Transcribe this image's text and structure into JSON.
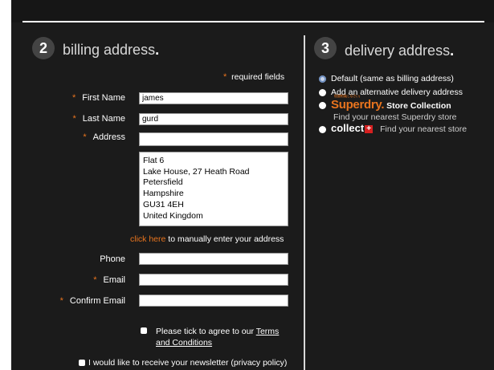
{
  "billing": {
    "step_number": "2",
    "title": "billing address",
    "required_note": "required fields",
    "first_name_label": "First Name",
    "first_name_value": "james",
    "last_name_label": "Last Name",
    "last_name_value": "gurd",
    "address_label": "Address",
    "address_value": "",
    "address_lines": [
      "Flat 6",
      "Lake House, 27 Heath Road",
      "Petersfield",
      "Hampshire",
      "GU31 4EH",
      "United Kingdom"
    ],
    "manual_link": "click here",
    "manual_text": " to manually enter your address",
    "phone_label": "Phone",
    "email_label": "Email",
    "confirm_email_label": "Confirm Email",
    "terms_prefix": "Please tick to agree to our ",
    "terms_link_1": "Terms",
    "terms_link_2": "and Conditions",
    "newsletter_text": "I would like to receive your newsletter (privacy policy)"
  },
  "delivery": {
    "step_number": "3",
    "title": "delivery address",
    "options": [
      {
        "label": "Default (same as billing address)"
      },
      {
        "label": "Add an alternative delivery address"
      }
    ],
    "superdry_logo": "Superdry.",
    "superdry_logo_small": "極度乾燥(しなさい)",
    "superdry_option": "Store Collection",
    "superdry_sub": "Find your nearest Superdry store",
    "collect_logo": "collect",
    "collect_plus": "+",
    "collect_sub": "Find your nearest store"
  },
  "colors": {
    "accent": "#e8741e",
    "background": "#1b1b1b"
  }
}
